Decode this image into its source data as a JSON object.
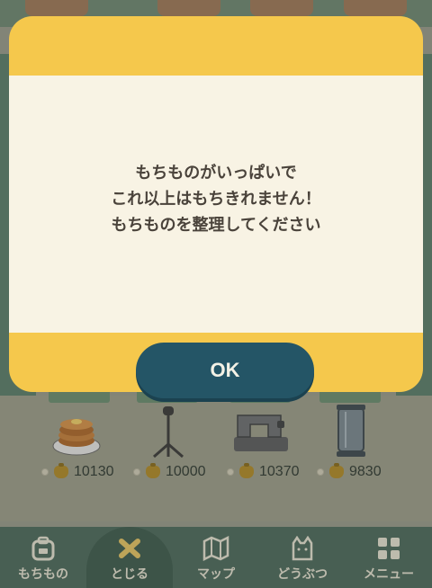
{
  "dialog": {
    "message_lines": [
      "もちものがいっぱいで",
      "これ以上はもちきれません！",
      "もちものを整理してください"
    ],
    "ok_label": "OK"
  },
  "shop_items": [
    {
      "name": "pancakes-icon",
      "price": "10130"
    },
    {
      "name": "mic-stand-icon",
      "price": "10000"
    },
    {
      "name": "sewing-machine-icon",
      "price": "10370"
    },
    {
      "name": "glass-lamp-icon",
      "price": "9830"
    }
  ],
  "nav": {
    "items": [
      {
        "label": "もちもの",
        "icon": "backpack-icon"
      },
      {
        "label": "とじる",
        "icon": "close-icon"
      },
      {
        "label": "マップ",
        "icon": "map-icon"
      },
      {
        "label": "どうぶつ",
        "icon": "animal-icon"
      },
      {
        "label": "メニュー",
        "icon": "menu-icon"
      }
    ],
    "active_index": 1
  },
  "colors": {
    "dialog_frame": "#f5c84c",
    "dialog_body": "#f8f3e4",
    "ok_button": "#245566",
    "nav_bg": "#4d6b5e"
  }
}
